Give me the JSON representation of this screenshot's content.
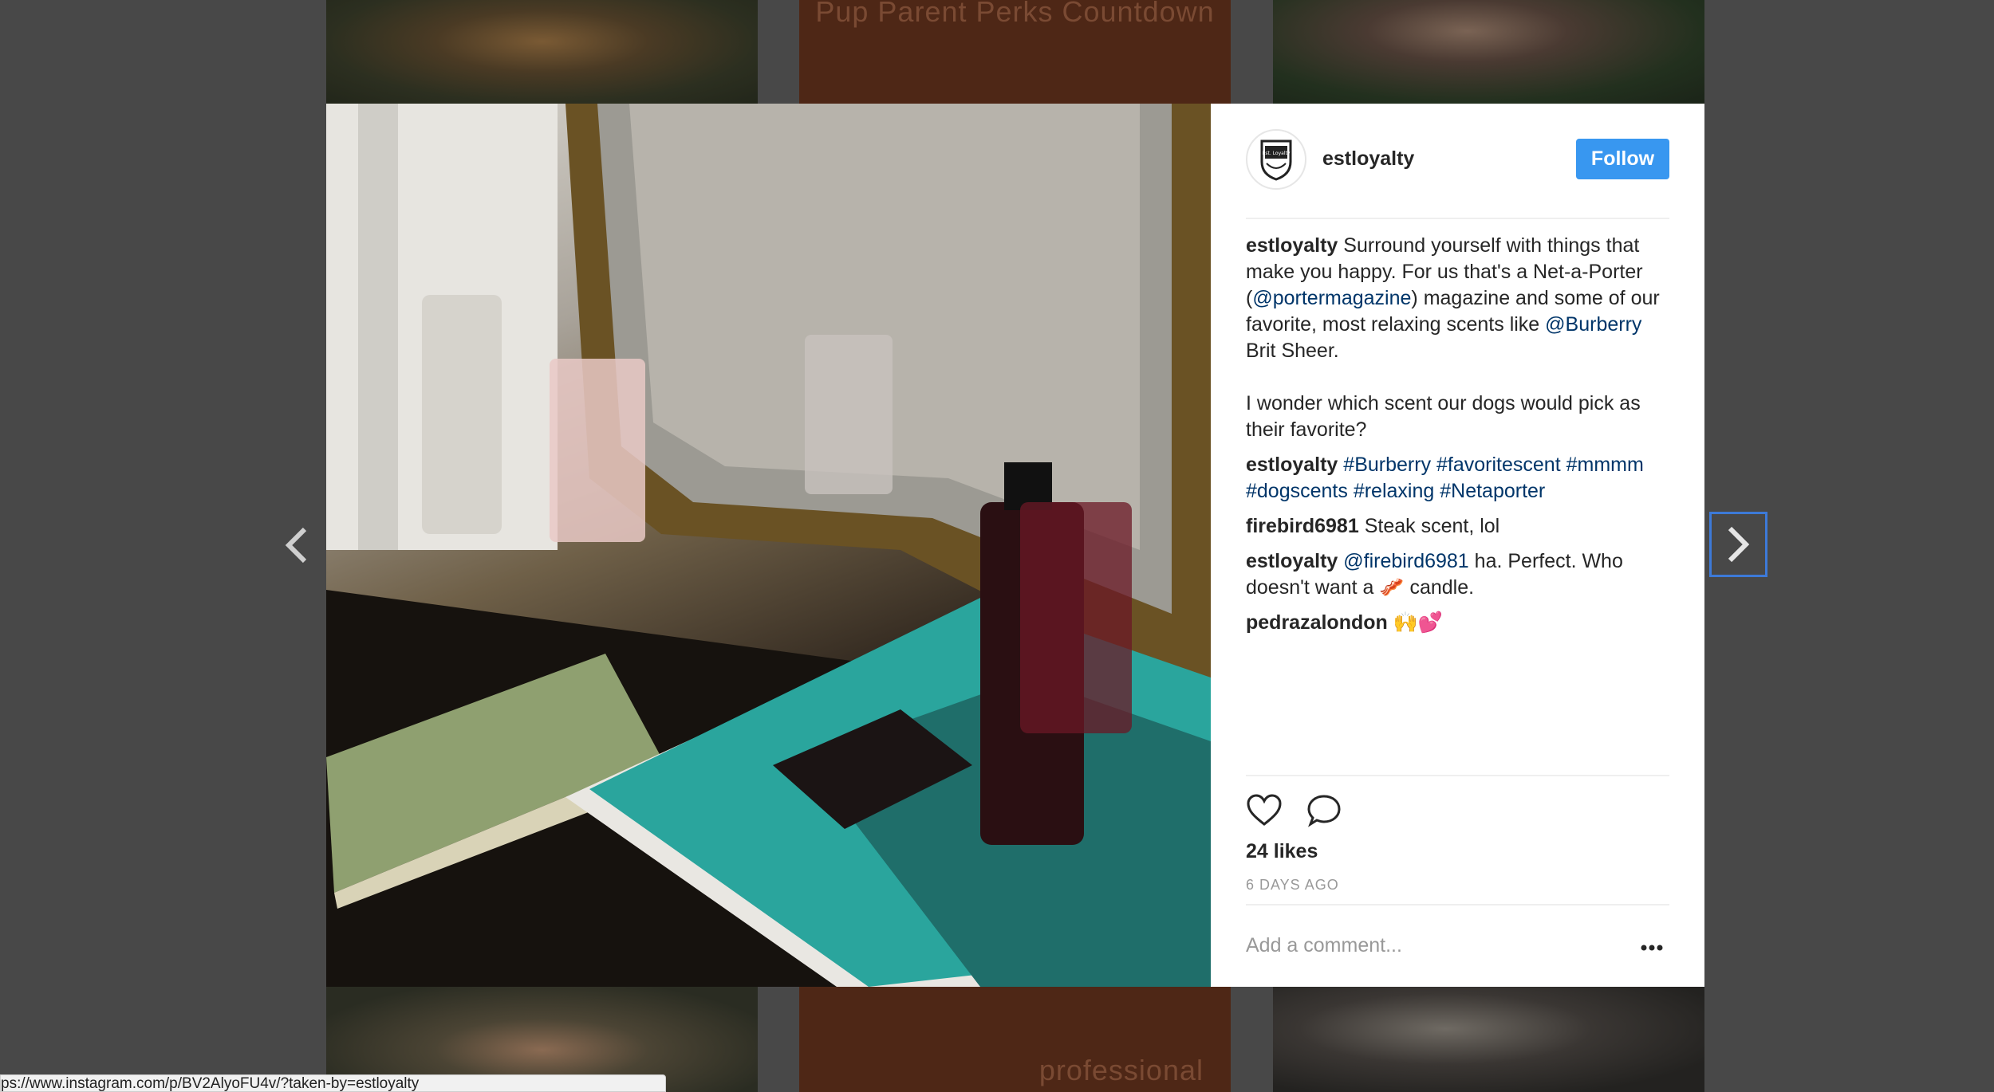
{
  "background": {
    "tile_top_text": "Pup Parent Perks Countdown",
    "tile_bottom_text": "professional"
  },
  "nav": {
    "prev_icon": "chevron-left-icon",
    "next_icon": "chevron-right-icon"
  },
  "post": {
    "username": "estloyalty",
    "avatar_text": "Est. Loyalty",
    "follow_label": "Follow",
    "caption": {
      "user": "estloyalty",
      "text_1": "Surround yourself with things that make you happy. For us that's a Net-a-Porter (",
      "mention_1": "@portermagazine",
      "text_2": ") magazine and some of our favorite, most relaxing scents like ",
      "mention_2": "@Burberry",
      "text_3": " Brit Sheer.",
      "text_4": "I wonder which scent our dogs would pick as their favorite?"
    },
    "hashtag_comment": {
      "user": "estloyalty",
      "tags": [
        "#Burberry",
        "#favoritescent",
        "#mmmm",
        "#dogscents",
        "#relaxing",
        "#Netaporter"
      ]
    },
    "comments": [
      {
        "user": "firebird6981",
        "text": "Steak scent, lol"
      },
      {
        "user": "estloyalty",
        "mention": "@firebird6981",
        "text": "ha. Perfect. Who doesn't want a 🥓 candle."
      },
      {
        "user": "pedrazalondon",
        "text": "🙌💕"
      }
    ],
    "likes": "24 likes",
    "timestamp": "6 DAYS AGO",
    "comment_placeholder": "Add a comment...",
    "accent_color": "#3897f0",
    "link_color": "#003569"
  },
  "status_bar": {
    "url": "ps://www.instagram.com/p/BV2AlyoFU4v/?taken-by=estloyalty"
  }
}
